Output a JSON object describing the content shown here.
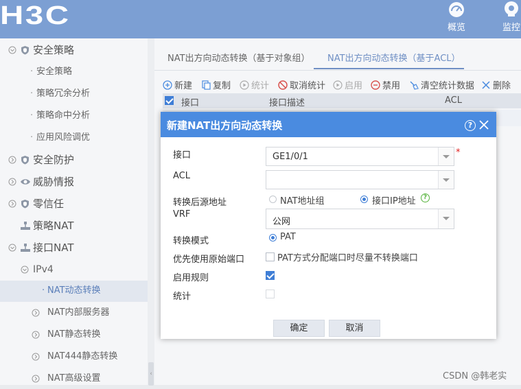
{
  "header": {
    "logo_text": "H3C",
    "nav": [
      {
        "label": "概览",
        "icon": "gauge-icon"
      },
      {
        "label": "监控",
        "icon": "monitor-camera-icon"
      }
    ]
  },
  "sidebar": {
    "items": [
      {
        "label": "安全策略",
        "level": "top",
        "icon": "shield-icon"
      },
      {
        "label": "安全策略",
        "level": "sub"
      },
      {
        "label": "策略冗余分析",
        "level": "sub"
      },
      {
        "label": "策略命中分析",
        "level": "sub"
      },
      {
        "label": "应用风险调优",
        "level": "sub"
      },
      {
        "label": "安全防护",
        "level": "top",
        "icon": "shield-icon"
      },
      {
        "label": "威胁情报",
        "level": "top",
        "icon": "eye-icon"
      },
      {
        "label": "零信任",
        "level": "top",
        "icon": "shield-icon"
      },
      {
        "label": "策略NAT",
        "level": "top",
        "icon": "network-icon"
      },
      {
        "label": "接口NAT",
        "level": "top",
        "icon": "network-icon"
      },
      {
        "label": "IPv4",
        "level": "group"
      },
      {
        "label": "NAT动态转换",
        "level": "leaf",
        "active": true
      },
      {
        "label": "NAT内部服务器",
        "level": "leaf"
      },
      {
        "label": "NAT静态转换",
        "level": "leaf"
      },
      {
        "label": "NAT444静态转换",
        "level": "leaf"
      },
      {
        "label": "NAT高级设置",
        "level": "leaf"
      }
    ]
  },
  "tabs": [
    {
      "label": "NAT出方向动态转换（基于对象组）",
      "active": false
    },
    {
      "label": "NAT出方向动态转换（基于ACL）",
      "active": true
    }
  ],
  "toolbar": [
    {
      "label": "新建",
      "icon": "plus-circle-icon",
      "enabled": true
    },
    {
      "label": "复制",
      "icon": "copy-icon",
      "enabled": true
    },
    {
      "label": "统计",
      "icon": "play-circle-icon",
      "enabled": false
    },
    {
      "label": "取消统计",
      "icon": "forbidden-icon",
      "enabled": true
    },
    {
      "label": "启用",
      "icon": "play-circle-icon",
      "enabled": false
    },
    {
      "label": "禁用",
      "icon": "minus-circle-icon",
      "enabled": true
    },
    {
      "label": "清空统计数据",
      "icon": "broom-icon",
      "enabled": true
    },
    {
      "label": "删除",
      "icon": "x-icon",
      "enabled": true
    }
  ],
  "table": {
    "columns": [
      "接口",
      "接口描述",
      "ACL"
    ]
  },
  "modal": {
    "title": "新建NAT出方向动态转换",
    "fields": {
      "interface_label": "接口",
      "interface_value": "GE1/0/1",
      "required_mark": "*",
      "acl_label": "ACL",
      "acl_value": "",
      "src_addr_label": "转换后源地址",
      "src_opt_nat_group": "NAT地址组",
      "src_opt_iface_ip": "接口IP地址",
      "vrf_label": "VRF",
      "vrf_value": "公网",
      "mode_label": "转换模式",
      "mode_opt_pat": "PAT",
      "prefer_label": "优先使用原始端口",
      "prefer_text": "PAT方式分配端口时尽量不转换端口",
      "enable_label": "启用规则",
      "stats_label": "统计"
    },
    "selected_source": "接口IP地址",
    "enable_rule_checked": true,
    "prefer_port_checked": false,
    "stats_checked": false,
    "buttons": {
      "ok": "确定",
      "cancel": "取消"
    }
  },
  "watermark": "CSDN @韩老实",
  "colors": {
    "topbar": "#7c9fd3",
    "modal_header": "#4a8be0",
    "accent": "#3f7ed6",
    "required": "#e02020"
  }
}
